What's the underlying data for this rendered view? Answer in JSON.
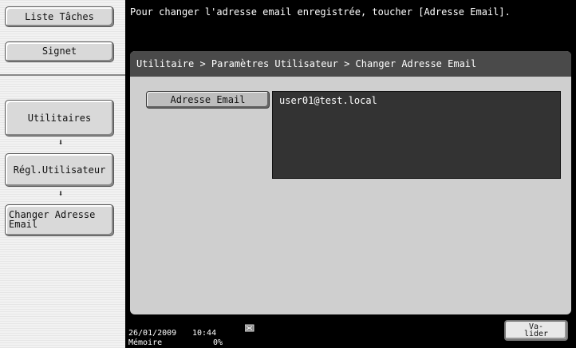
{
  "sidebar": {
    "job_list_label": "Liste Tâches",
    "bookmark_label": "Signet",
    "utilities_label": "Utilitaires",
    "user_settings_label": "Régl.Utilisateur",
    "change_email_label": "Changer Adresse Email"
  },
  "message": "Pour changer l'adresse email enregistrée, toucher [Adresse Email].",
  "breadcrumb": "Utilitaire > Paramètres Utilisateur > Changer Adresse Email",
  "email_button_label": "Adresse Email",
  "email_value": "user01@test.local",
  "status": {
    "date": "26/01/2009",
    "time": "10:44",
    "memory_label": "Mémoire",
    "memory_value": "0%"
  },
  "ok_button_label": "Va-\nlider",
  "icons": {
    "arrow": "down-arrow-icon",
    "status": "toner-icon"
  }
}
